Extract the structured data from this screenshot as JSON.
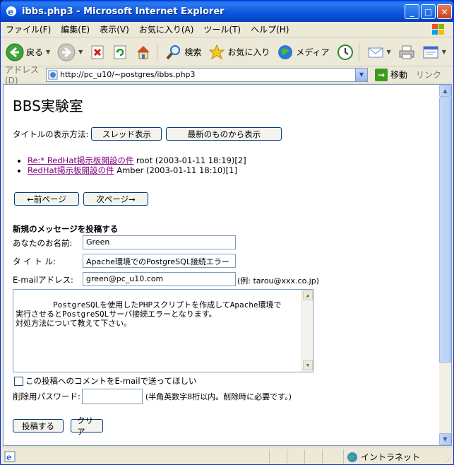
{
  "window": {
    "title": "ibbs.php3 - Microsoft Internet Explorer",
    "min_glyph": "_",
    "max_glyph": "□",
    "close_glyph": "✕"
  },
  "menu": [
    "ファイル(F)",
    "編集(E)",
    "表示(V)",
    "お気に入り(A)",
    "ツール(T)",
    "ヘルプ(H)"
  ],
  "toolbar": {
    "back_label": "戻る",
    "search_label": "検索",
    "favorites_label": "お気に入り",
    "media_label": "メディア",
    "icons": [
      "back-icon",
      "forward-icon",
      "stop-icon",
      "refresh-icon",
      "home-icon",
      "search-icon",
      "favorites-icon",
      "media-icon",
      "history-icon",
      "mail-icon",
      "print-icon",
      "edit-icon"
    ]
  },
  "address": {
    "label": "アドレス(D)",
    "url": "http://pc_u10/~postgres/ibbs.php3",
    "go_label": "移動",
    "links_label": "リンク"
  },
  "page": {
    "title": "BBS実験室",
    "display_mode_label": "タイトルの表示方法:",
    "thread_button": "スレッド表示",
    "latest_button": "最新のものから表示",
    "posts": [
      {
        "subject": "Re:* RedHat掲示板開設の件",
        "meta": " root (2003-01-11 18:19)[2]"
      },
      {
        "subject": "RedHat掲示板開設の件",
        "meta": " Amber (2003-01-11 18:10)[1]"
      }
    ],
    "prev_button": "←前ページ",
    "next_button": "次ページ→",
    "new_post_heading": "新規のメッセージを投稿する",
    "name_label": "あなたのお名前:",
    "name_value": "Green",
    "subject_label": "タ イ ト ル:",
    "subject_value": "Apache環境でのPostgreSQL接続エラー",
    "email_label": "E-mailアドレス:",
    "email_value": "green@pc_u10.com",
    "email_hint": "(例: tarou@xxx.co.jp)",
    "message_value": "PostgreSQLを使用したPHPスクリプトを作成してApache環境で\n実行させるとPostgreSQLサーバ接続エラーとなります。\n対処方法について教えて下さい。",
    "notify_label": "この投稿へのコメントをE-mailで送ってほしい",
    "password_label": "削除用パスワード:",
    "password_hint": "(半角英数字8桁以内。削除時に必要です。)",
    "submit_button": "投稿する",
    "clear_button": "クリア"
  },
  "status": {
    "zone_label": "イントラネット"
  },
  "colors": {
    "titlebar": "#0a5fe9",
    "visited_link": "#800080",
    "page_bg": "#ffffff"
  }
}
